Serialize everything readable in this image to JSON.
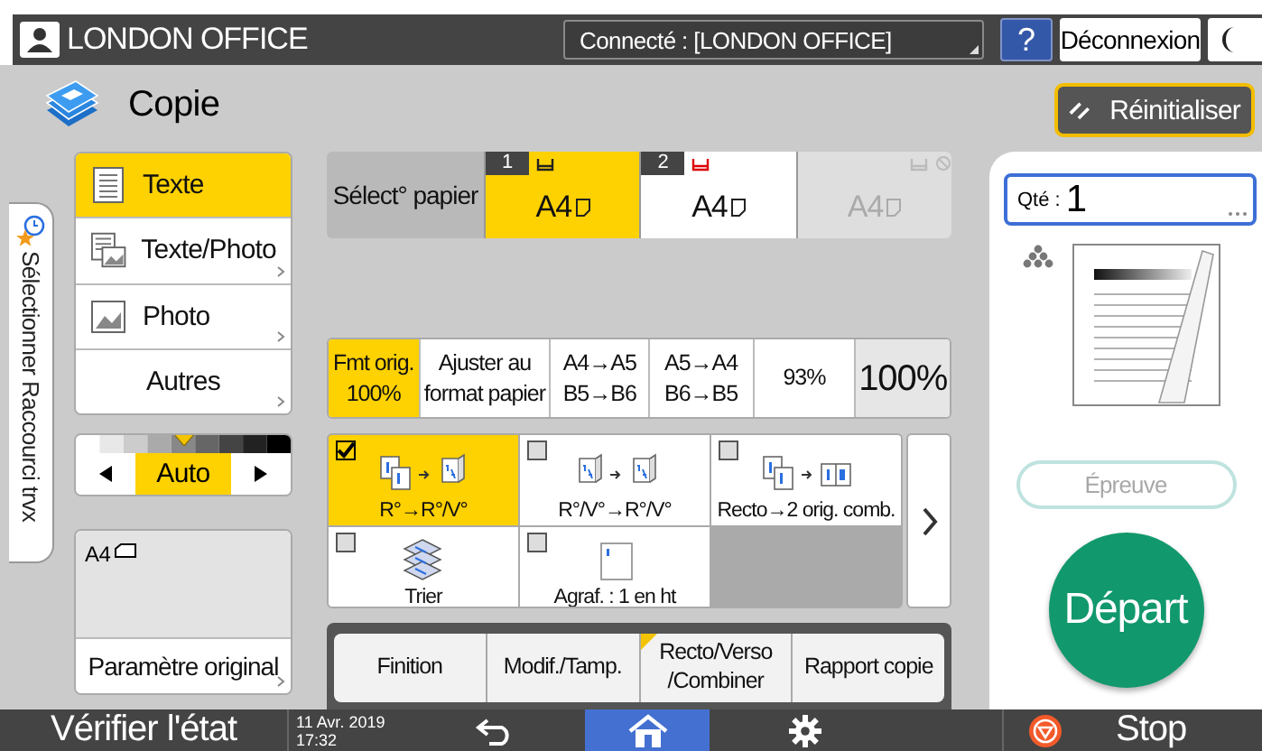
{
  "top_bar": {
    "user": "LONDON OFFICE",
    "connection": "Connecté : [LONDON OFFICE]",
    "help": "?",
    "logout": "Déconnexion"
  },
  "header": {
    "title": "Copie",
    "reset": "Réinitialiser"
  },
  "shortcut_tab": "Sélectionner Raccourci trvx",
  "original_types": [
    {
      "label": "Texte",
      "kind": "text",
      "selected": true
    },
    {
      "label": "Texte/Photo",
      "kind": "text-photo",
      "selected": false
    },
    {
      "label": "Photo",
      "kind": "photo",
      "selected": false
    },
    {
      "label": "Autres",
      "kind": "other",
      "selected": false
    }
  ],
  "density": {
    "level": 0.5,
    "value": "Auto"
  },
  "original_settings": {
    "size": "A4",
    "label": "Paramètre original"
  },
  "paper": {
    "label": "Sélect° papier",
    "trays": [
      {
        "number": "1",
        "size": "A4",
        "selected": true,
        "disabled": false
      },
      {
        "number": "2",
        "size": "A4",
        "selected": false,
        "disabled": false
      },
      {
        "size": "A4",
        "selected": false,
        "disabled": true
      }
    ]
  },
  "ratios": [
    {
      "label": "Fmt orig.\n100%",
      "kind": "preset",
      "selected": true
    },
    {
      "label": "Ajuster au\nformat papier",
      "kind": "preset",
      "selected": false
    },
    {
      "label": "A4→A5\nB5→B6",
      "kind": "preset",
      "selected": false
    },
    {
      "label": "A5→A4\nB6→B5",
      "kind": "preset",
      "selected": false
    },
    {
      "label": "93%",
      "kind": "preset",
      "selected": false
    },
    {
      "label": "100%",
      "kind": "custom",
      "selected": false
    }
  ],
  "functions": [
    {
      "label": "R°→R°/V°",
      "kind": "one-to-duplex",
      "checked": true
    },
    {
      "label": "R°/V°→R°/V°",
      "kind": "duplex-to-duplex",
      "checked": false
    },
    {
      "label": "Recto→2 orig. comb.",
      "kind": "combine",
      "checked": false
    },
    {
      "label": "Trier",
      "kind": "sort",
      "checked": false
    },
    {
      "label": "Agraf. : 1 en ht",
      "kind": "staple",
      "checked": false
    }
  ],
  "tabs": [
    {
      "label": "Finition",
      "flagged": false
    },
    {
      "label": "Modif./Tamp.",
      "flagged": false
    },
    {
      "label": "Recto/Verso\n/Combiner",
      "flagged": true
    },
    {
      "label": "Rapport copie",
      "flagged": false
    }
  ],
  "quantity": {
    "label": "Qté :",
    "value": "1"
  },
  "proof": {
    "label": "Épreuve",
    "disabled": true
  },
  "start": "Départ",
  "status_bar": {
    "check": "Vérifier l'état",
    "date": "11 Avr. 2019",
    "time": "17:32",
    "stop": "Stop"
  }
}
